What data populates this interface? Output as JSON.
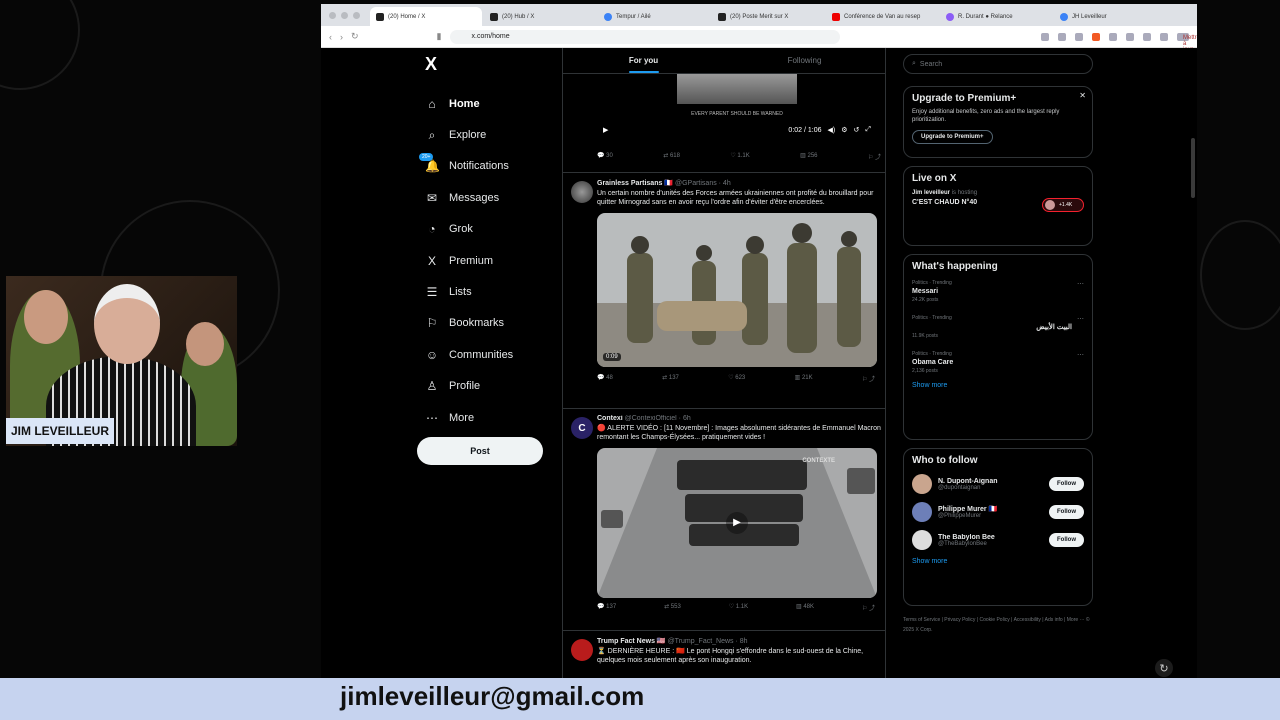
{
  "browser": {
    "tabs": [
      {
        "label": "(20) Home / X",
        "active": true
      },
      {
        "label": "(20) Hub / X",
        "active": false
      },
      {
        "label": "Tempur / Ailé",
        "active": false
      },
      {
        "label": "(20) Poste Merit sur X",
        "active": false
      },
      {
        "label": "Conférence de Van au resep",
        "active": false
      },
      {
        "label": "R. Durant ● Relance",
        "active": false
      },
      {
        "label": "JH Leveilleur",
        "active": false
      }
    ],
    "url": "x.com/home",
    "relaunch_label": "Mettre à jour"
  },
  "x": {
    "logo": "X",
    "nav": [
      {
        "label": "Home",
        "icon": "home-icon",
        "glyph": "⌂",
        "active": true
      },
      {
        "label": "Explore",
        "icon": "search-icon",
        "glyph": "⌕"
      },
      {
        "label": "Notifications",
        "icon": "bell-icon",
        "glyph": "🔔",
        "badge": "20+"
      },
      {
        "label": "Messages",
        "icon": "mail-icon",
        "glyph": "✉"
      },
      {
        "label": "Grok",
        "icon": "grok-icon",
        "glyph": "◔"
      },
      {
        "label": "Premium",
        "icon": "x-premium-icon",
        "glyph": "X"
      },
      {
        "label": "Lists",
        "icon": "list-icon",
        "glyph": "☰"
      },
      {
        "label": "Bookmarks",
        "icon": "bookmark-icon",
        "glyph": "⚐"
      },
      {
        "label": "Communities",
        "icon": "people-icon",
        "glyph": "☺"
      },
      {
        "label": "Profile",
        "icon": "user-icon",
        "glyph": "♙"
      },
      {
        "label": "More",
        "icon": "more-icon",
        "glyph": "⋯"
      }
    ],
    "post_label": "Post",
    "timeline_tabs": [
      "For you",
      "Following"
    ],
    "top_video": {
      "caption": "EVERY PARENT SHOULD BE WARNED",
      "time": "0:02 / 1:06",
      "stats": [
        "30",
        "618",
        "1.1K",
        "256"
      ]
    },
    "tweets": [
      {
        "name": "Grainless Partisans 🇫🇷",
        "handle": "@GPartisans · 4h",
        "text": "Un certain nombre d'unités des Forces armées ukrainiennes ont profité du brouillard pour quitter Mirnograd sans en avoir reçu l'ordre afin d'éviter d'être encerclées.",
        "duration": "0:09",
        "stats": [
          "48",
          "137",
          "623",
          "21K"
        ]
      },
      {
        "name": "Contexi",
        "handle": "@ContexiOfficiel · 6h",
        "text": "🔴 ALERTE VIDÉO : [11 Novembre] : Images absolument sidérantes de Emmanuel Macron remontant les Champs-Élysées... pratiquement vides !",
        "overlay": "CONTEXTE",
        "stats": [
          "137",
          "553",
          "1.1K",
          "48K"
        ]
      },
      {
        "name": "Trump Fact News 🇺🇸",
        "handle": "@Trump_Fact_News · 8h",
        "text": "⏳ DERNIÈRE HEURE : 🇨🇳 Le pont Hongqi s'effondre dans le sud-ouest de la Chine, quelques mois seulement après son inauguration."
      }
    ],
    "search_placeholder": "Search",
    "premium": {
      "title": "Upgrade to Premium+",
      "text": "Enjoy additional benefits, zero ads and the largest reply prioritization.",
      "button": "Upgrade to Premium+"
    },
    "live": {
      "title": "Live on X",
      "host": "Jim leveilleur",
      "status": "is hosting",
      "show": "C'EST CHAUD N°40",
      "count": "+1.4K"
    },
    "happening": {
      "title": "What's happening",
      "trends": [
        {
          "meta": "Politics · Trending",
          "name": "Messari",
          "count": "24.2K posts"
        },
        {
          "meta": "Politics · Trending",
          "name": "البيت الأبيض",
          "count": "11.9K posts",
          "rtl": true
        },
        {
          "meta": "Politics · Trending",
          "name": "Obama Care",
          "count": "2,136 posts"
        }
      ],
      "show_more": "Show more"
    },
    "who_to_follow": {
      "title": "Who to follow",
      "accounts": [
        {
          "name": "N. Dupont-Aignan",
          "handle": "@dupontaignan"
        },
        {
          "name": "Philippe Murer 🇫🇷",
          "handle": "@PhilippeMurer"
        },
        {
          "name": "The Babylon Bee",
          "handle": "@TheBabylonBee"
        }
      ],
      "follow_label": "Follow",
      "show_more": "Show more"
    },
    "footer": "Terms of Service | Privacy Policy | Cookie Policy | Accessibility | Ads info | More ··· © 2025 X Corp."
  },
  "overlay": {
    "cam_name": "JIM LEVEILLEUR",
    "email": "jimleveilleur@gmail.com"
  }
}
